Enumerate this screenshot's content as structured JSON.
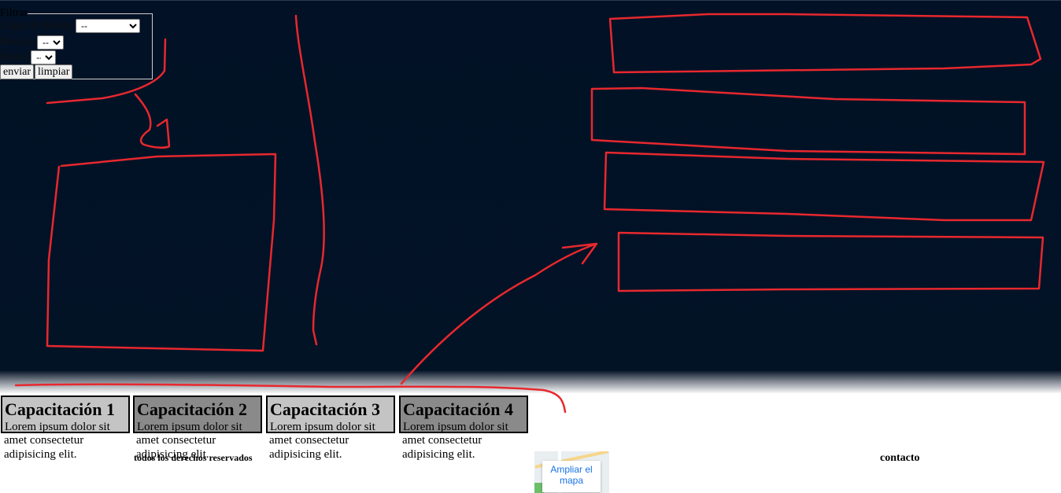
{
  "filters": {
    "legend": "Filtrar",
    "fields": [
      {
        "label": "Lugar de trabajo",
        "value": "--"
      },
      {
        "label": "Horario",
        "value": "--"
      },
      {
        "label": "Barrio",
        "value": "--"
      }
    ],
    "submit_label": "enviar",
    "reset_label": "limpiar"
  },
  "cards": [
    {
      "title": "Capacitación 1",
      "text_line1": "Lorem ipsum dolor sit",
      "text_rest": "amet consectetur adipisicing elit.",
      "head_color": "#c4c4c4"
    },
    {
      "title": "Capacitación 2",
      "text_line1": "Lorem ipsum dolor sit",
      "text_rest": "amet consectetur adipisicing elit.",
      "head_color": "#8a8a8a"
    },
    {
      "title": "Capacitación 3",
      "text_line1": "Lorem ipsum dolor sit",
      "text_rest": "amet consectetur adipisicing elit.",
      "head_color": "#c4c4c4"
    },
    {
      "title": "Capacitación 4",
      "text_line1": "Lorem ipsum dolor sit",
      "text_rest": "amet consectetur adipisicing elit.",
      "head_color": "#8a8a8a"
    }
  ],
  "footer": {
    "rights": "todos los derechos reservados",
    "map_button": "Ampliar el mapa",
    "contact": "contacto"
  },
  "colors": {
    "hero_background": "#021125",
    "annotation_stroke": "#e8282e"
  }
}
